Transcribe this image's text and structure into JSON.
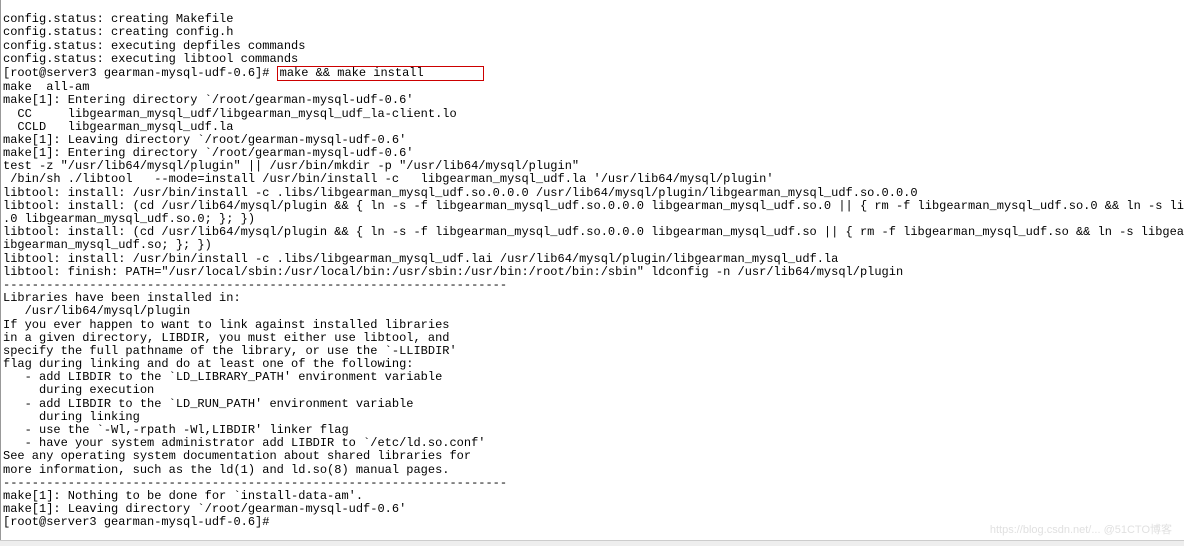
{
  "terminal": {
    "lines": [
      "config.status: creating Makefile",
      "config.status: creating config.h",
      "config.status: executing depfiles commands",
      "config.status: executing libtool commands"
    ],
    "prompt1": "[root@server3 gearman-mysql-udf-0.6]#",
    "highlighted_cmd": "make && make install        ",
    "lines2": [
      "make  all-am",
      "make[1]: Entering directory `/root/gearman-mysql-udf-0.6'",
      "  CC     libgearman_mysql_udf/libgearman_mysql_udf_la-client.lo",
      "  CCLD   libgearman_mysql_udf.la",
      "make[1]: Leaving directory `/root/gearman-mysql-udf-0.6'",
      "make[1]: Entering directory `/root/gearman-mysql-udf-0.6'",
      "test -z \"/usr/lib64/mysql/plugin\" || /usr/bin/mkdir -p \"/usr/lib64/mysql/plugin\"",
      " /bin/sh ./libtool   --mode=install /usr/bin/install -c   libgearman_mysql_udf.la '/usr/lib64/mysql/plugin'",
      "libtool: install: /usr/bin/install -c .libs/libgearman_mysql_udf.so.0.0.0 /usr/lib64/mysql/plugin/libgearman_mysql_udf.so.0.0.0",
      "libtool: install: (cd /usr/lib64/mysql/plugin && { ln -s -f libgearman_mysql_udf.so.0.0.0 libgearman_mysql_udf.so.0 || { rm -f libgearman_mysql_udf.so.0 && ln -s libgearman_m",
      ".0 libgearman_mysql_udf.so.0; }; })",
      "libtool: install: (cd /usr/lib64/mysql/plugin && { ln -s -f libgearman_mysql_udf.so.0.0.0 libgearman_mysql_udf.so || { rm -f libgearman_mysql_udf.so && ln -s libgearman_mysql",
      "ibgearman_mysql_udf.so; }; })",
      "libtool: install: /usr/bin/install -c .libs/libgearman_mysql_udf.lai /usr/lib64/mysql/plugin/libgearman_mysql_udf.la",
      "libtool: finish: PATH=\"/usr/local/sbin:/usr/local/bin:/usr/sbin:/usr/bin:/root/bin:/sbin\" ldconfig -n /usr/lib64/mysql/plugin",
      "----------------------------------------------------------------------",
      "Libraries have been installed in:",
      "   /usr/lib64/mysql/plugin",
      "",
      "If you ever happen to want to link against installed libraries",
      "in a given directory, LIBDIR, you must either use libtool, and",
      "specify the full pathname of the library, or use the `-LLIBDIR'",
      "flag during linking and do at least one of the following:",
      "   - add LIBDIR to the `LD_LIBRARY_PATH' environment variable",
      "     during execution",
      "   - add LIBDIR to the `LD_RUN_PATH' environment variable",
      "     during linking",
      "   - use the `-Wl,-rpath -Wl,LIBDIR' linker flag",
      "   - have your system administrator add LIBDIR to `/etc/ld.so.conf'",
      "",
      "See any operating system documentation about shared libraries for",
      "more information, such as the ld(1) and ld.so(8) manual pages.",
      "----------------------------------------------------------------------",
      "make[1]: Nothing to be done for `install-data-am'.",
      "make[1]: Leaving directory `/root/gearman-mysql-udf-0.6'",
      "[root@server3 gearman-mysql-udf-0.6]#"
    ]
  },
  "watermark": "https://blog.csdn.net/... @51CTO博客"
}
